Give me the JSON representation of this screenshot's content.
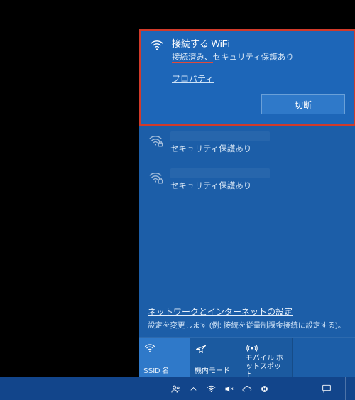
{
  "flyout": {
    "connected": {
      "name": "接続する WiFi",
      "status_prefix": "接続済み、",
      "status_suffix": "セキュリティ保護あり",
      "properties_label": "プロパティ",
      "disconnect_label": "切断"
    },
    "networks": [
      {
        "status": "セキュリティ保護あり"
      },
      {
        "status": "セキュリティ保護あり"
      }
    ],
    "settings": {
      "link": "ネットワークとインターネットの設定",
      "desc": "設定を変更します (例: 接続を従量制課金接続に設定する)。"
    },
    "tiles": {
      "wifi": "SSID 名",
      "airplane": "機内モード",
      "hotspot": "モバイル ホットスポット"
    }
  }
}
